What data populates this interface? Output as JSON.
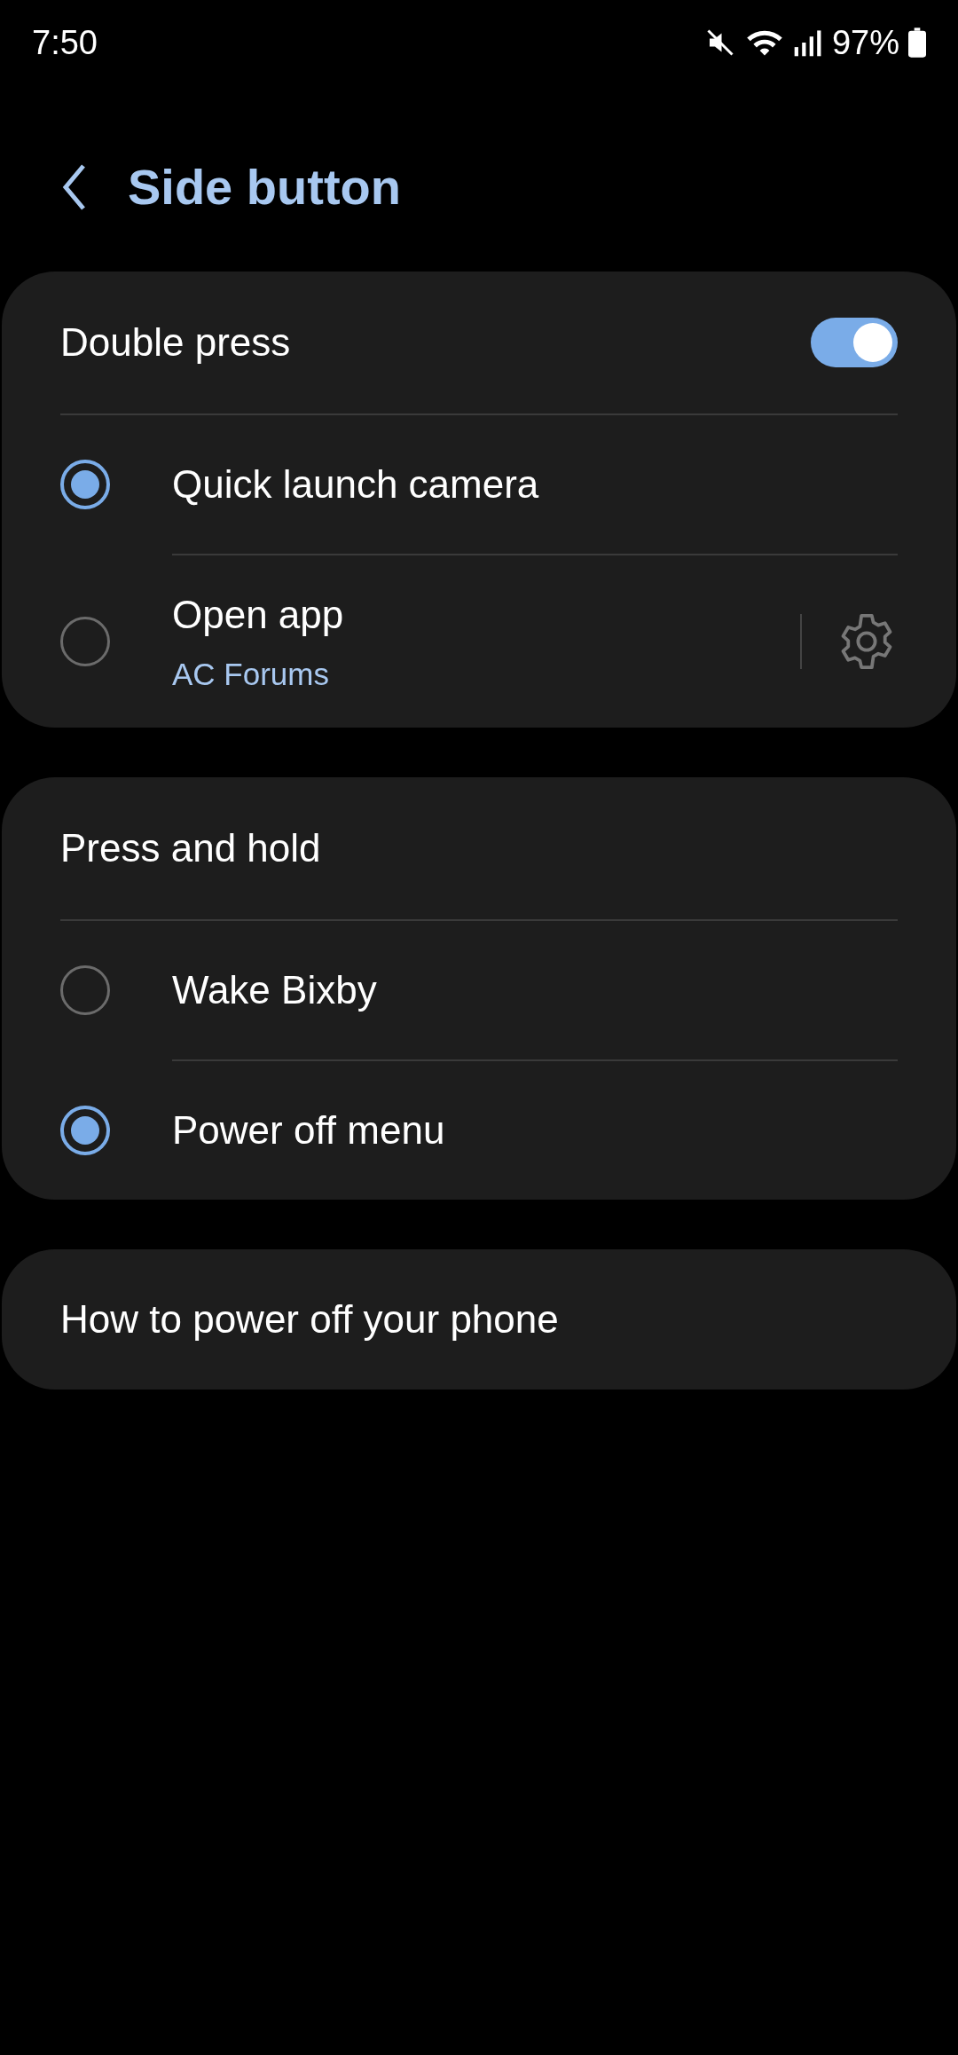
{
  "status_bar": {
    "time": "7:50",
    "battery_text": "97%"
  },
  "header": {
    "title": "Side button"
  },
  "sections": [
    {
      "header": {
        "label": "Double press",
        "kind": "switch",
        "on": true
      },
      "options": [
        {
          "label": "Quick launch camera",
          "selected": true
        },
        {
          "label": "Open app",
          "subtitle": "AC Forums",
          "selected": false,
          "settings": true
        }
      ]
    },
    {
      "header": {
        "label": "Press and hold",
        "kind": "plain"
      },
      "options": [
        {
          "label": "Wake Bixby",
          "selected": false
        },
        {
          "label": "Power off menu",
          "selected": true
        }
      ]
    }
  ],
  "links": [
    {
      "label": "How to power off your phone"
    }
  ]
}
